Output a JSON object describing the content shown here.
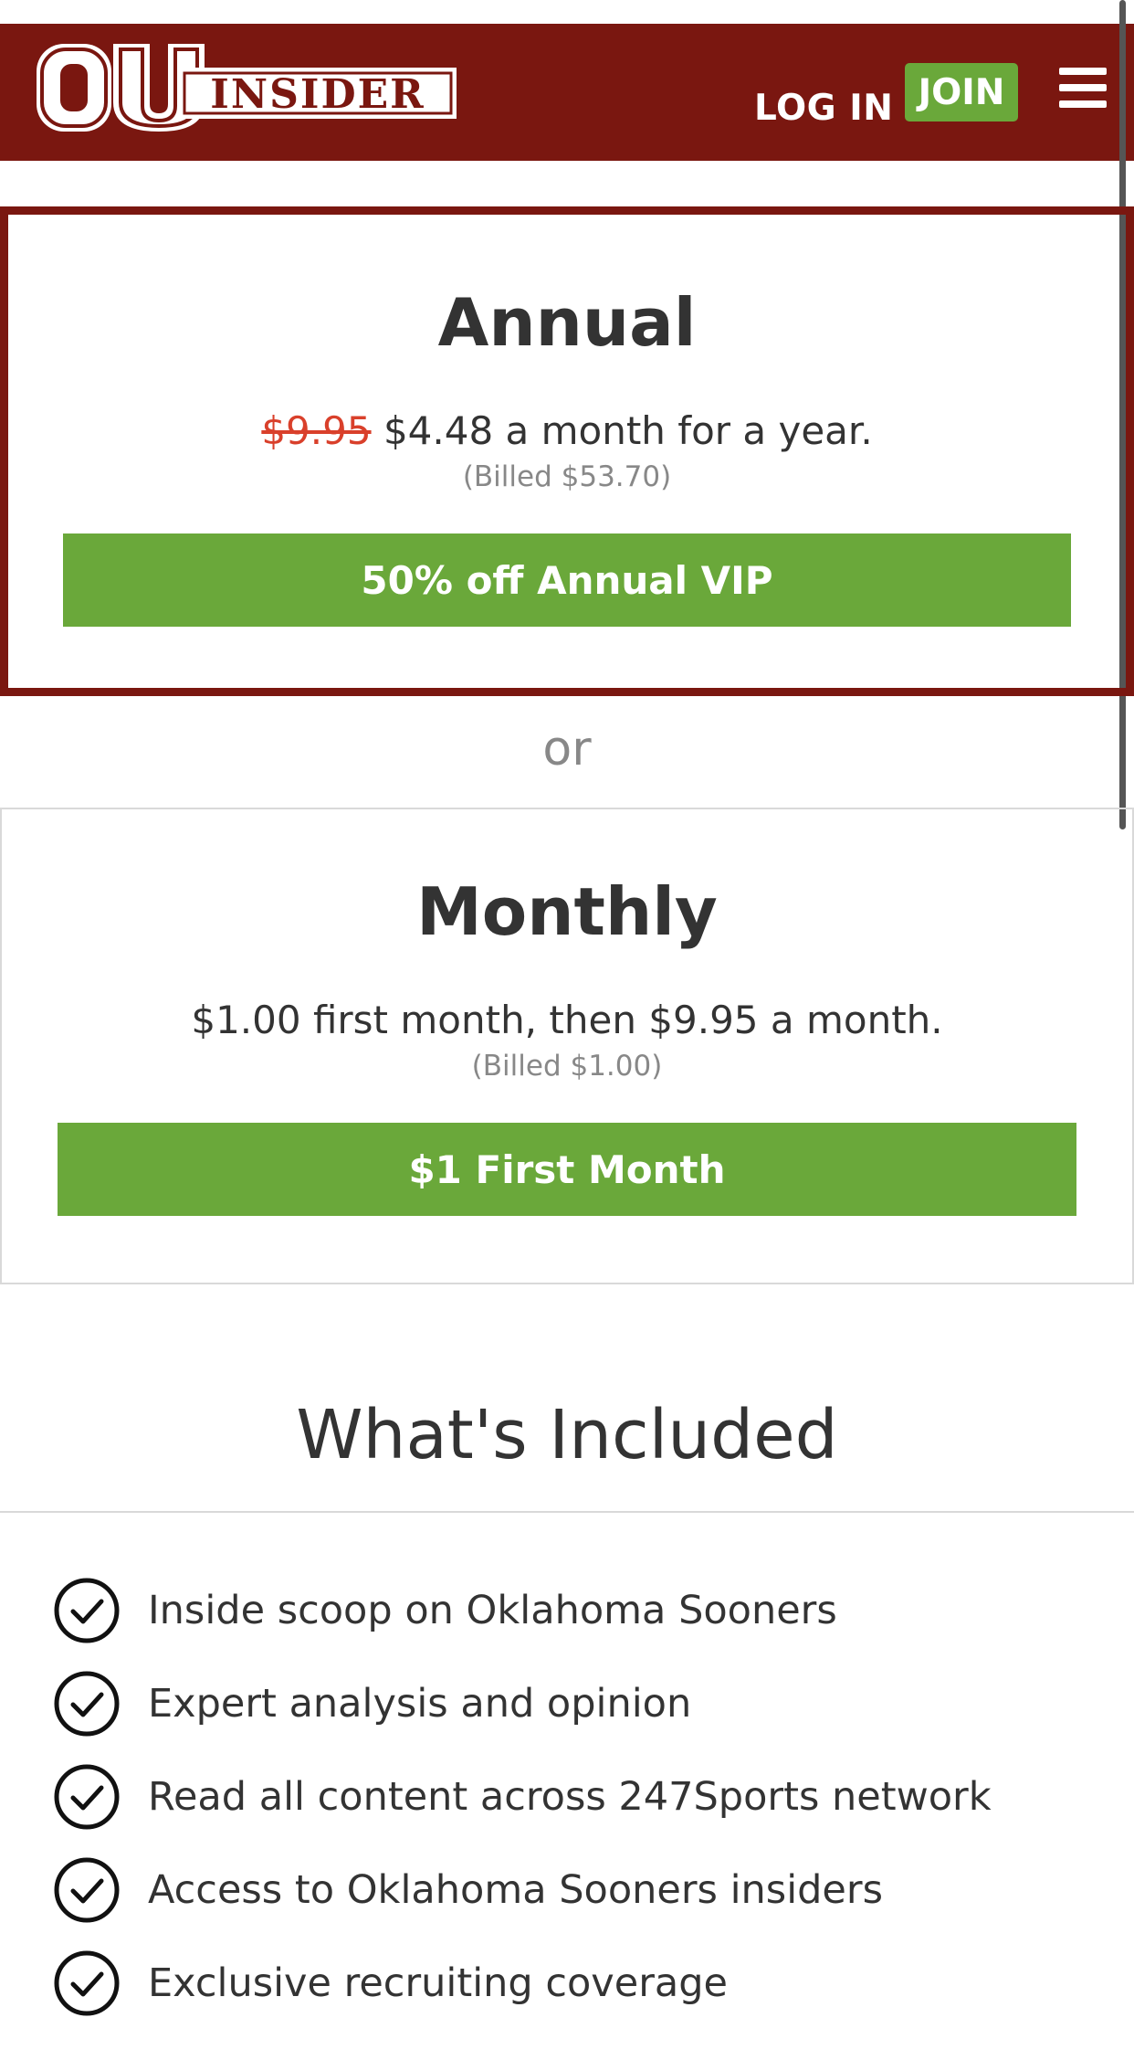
{
  "header": {
    "logo_text": "OUINSIDER",
    "login_label": "LOG IN",
    "join_label": "JOIN",
    "brand_color": "#7a1710",
    "accent_color": "#6aa83a"
  },
  "plans": [
    {
      "title": "Annual",
      "original_price": "$9.95",
      "price_text": "$4.48 a month for a year.",
      "billed": "(Billed $53.70)",
      "cta_label": "50% off Annual VIP",
      "selected": true
    },
    {
      "title": "Monthly",
      "price_text": "$1.00 first month, then $9.95 a month.",
      "billed": "(Billed $1.00)",
      "cta_label": "$1 First Month",
      "selected": false
    }
  ],
  "separator_text": "or",
  "included": {
    "title": "What's Included",
    "items": [
      {
        "label": "Inside scoop on Oklahoma Sooners",
        "icon": "check-circle-icon"
      },
      {
        "label": "Expert analysis and opinion",
        "icon": "check-circle-icon"
      },
      {
        "label": "Read all content across 247Sports network",
        "icon": "check-circle-icon"
      },
      {
        "label": "Access to Oklahoma Sooners insiders",
        "icon": "check-circle-icon"
      },
      {
        "label": "Exclusive recruiting coverage",
        "icon": "check-circle-icon"
      }
    ]
  }
}
